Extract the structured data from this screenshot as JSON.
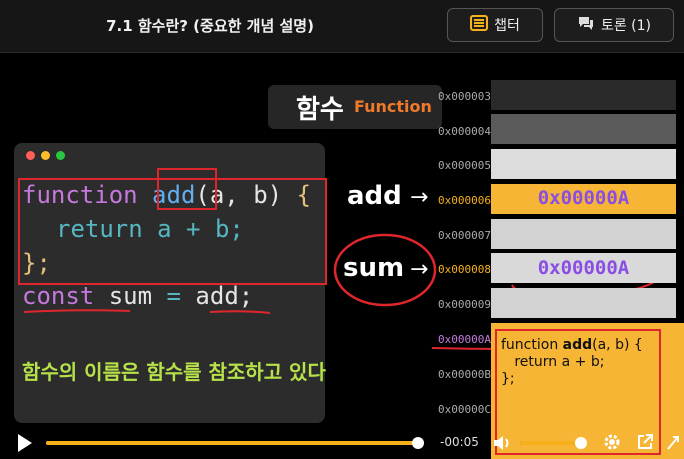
{
  "header": {
    "title": "7.1 함수란? (중요한 개념 설명)",
    "chapter_label": "챕터",
    "discussion_label": "토론 (1)"
  },
  "slide": {
    "badge_ko": "함수",
    "badge_en": "Function",
    "code_line1_kw": "function",
    "code_line1_fn": "add",
    "code_line1_args": "(a, b)",
    "code_line1_brace": "{",
    "code_line2": "return a + b;",
    "code_line3": "};",
    "code_line4_kw": "const",
    "code_line4_name": "sum",
    "code_line4_eq": "=",
    "code_line4_val": "add;",
    "caption": "함수의 이름은 함수를 참조하고 있다",
    "label_add": "add",
    "label_sum": "sum",
    "arrow": "→",
    "addresses": [
      "0x000003",
      "0x000004",
      "0x000005",
      "0x000006",
      "0x000007",
      "0x000008",
      "0x000009",
      "0x00000A",
      "0x00000B",
      "0x00000C"
    ],
    "cell_add_value": "0x00000A",
    "cell_sum_value": "0x00000A",
    "func_cell_line1_a": "function ",
    "func_cell_line1_b": "add",
    "func_cell_line1_c": "(a, b) {",
    "func_cell_line2": "   return a + b;",
    "func_cell_line3": "};"
  },
  "player": {
    "time_remaining": "-00:05",
    "progress": 0.985,
    "volume": 0.95
  },
  "colors": {
    "accent": "#f5b01a",
    "highlight_red": "#e0262d",
    "memory_value": "#8a4de6",
    "caption": "#b7e24a"
  }
}
